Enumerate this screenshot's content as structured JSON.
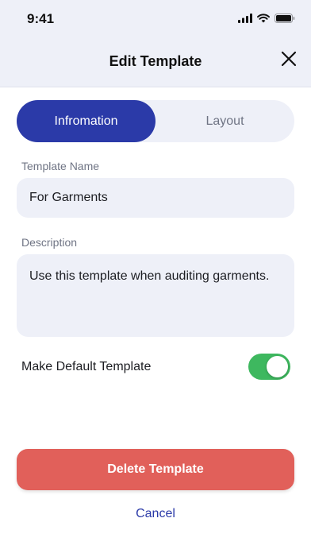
{
  "status_bar": {
    "time": "9:41",
    "icons": [
      "cellular-signal-icon",
      "wifi-icon",
      "battery-icon"
    ]
  },
  "header": {
    "title": "Edit Template",
    "close_icon": "close-icon"
  },
  "tabs": [
    {
      "label": "Infromation",
      "active": true
    },
    {
      "label": "Layout",
      "active": false
    }
  ],
  "form": {
    "name_label": "Template Name",
    "name_value": "For Garments",
    "description_label": "Description",
    "description_value": "Use this template when auditing garments.",
    "default_label": "Make Default Template",
    "default_enabled": true
  },
  "actions": {
    "delete_label": "Delete Template",
    "cancel_label": "Cancel"
  },
  "colors": {
    "primary": "#2b3aa8",
    "danger": "#e1605a",
    "toggle_on": "#3eb85f",
    "surface": "#eef0f8"
  }
}
